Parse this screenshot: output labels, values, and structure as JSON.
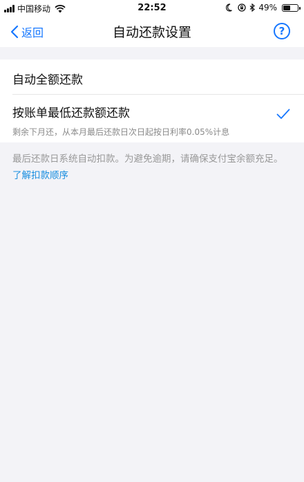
{
  "status_bar": {
    "carrier": "中国移动",
    "time": "22:52",
    "battery": "49%",
    "battery_level": 0.49
  },
  "nav": {
    "back_label": "返回",
    "title": "自动还款设置",
    "help_label": "?"
  },
  "options": [
    {
      "title": "自动全额还款",
      "selected": false
    },
    {
      "title": "按账单最低还款额还款",
      "subtitle": "剩余下月还，从本月最后还款日次日起按日利率0.05%计息",
      "selected": true
    }
  ],
  "note": {
    "text": "最后还款日系统自动扣款。为避免逾期，请确保支付宝余额充足。",
    "link": "了解扣款顺序"
  },
  "colors": {
    "accent": "#1677ff",
    "link": "#1a8fe0",
    "background": "#f3f3f7"
  }
}
